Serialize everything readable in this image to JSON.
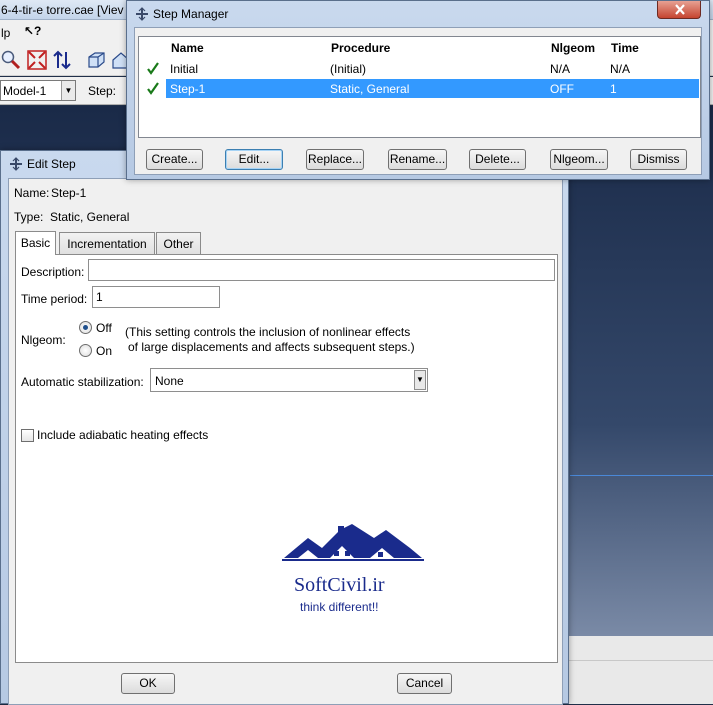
{
  "app": {
    "title": "6-4-tir-e torre.cae [Viev",
    "menu_help": "lp",
    "whatsthis": "↖?",
    "model_value": "Model-1",
    "step_label": "Step:"
  },
  "edit_step": {
    "title": "Edit Step",
    "name_label": "Name:",
    "name_value": "Step-1",
    "type_label": "Type:",
    "type_value": "Static, General",
    "tabs": [
      {
        "label": "Basic",
        "active": true
      },
      {
        "label": "Incrementation",
        "active": false
      },
      {
        "label": "Other",
        "active": false
      }
    ],
    "description_label": "Description:",
    "description_value": "",
    "time_period_label": "Time period:",
    "time_period_value": "1",
    "nlgeom_label": "Nlgeom:",
    "nlgeom_off_label": "Off",
    "nlgeom_on_label": "On",
    "nlgeom_selected": "Off",
    "nlgeom_note_line1": "(This setting controls the inclusion of nonlinear effects",
    "nlgeom_note_line2": "of large displacements and affects subsequent steps.)",
    "stabilization_label": "Automatic stabilization:",
    "stabilization_value": "None",
    "adiabatic_label": "Include adiabatic heating effects",
    "adiabatic_checked": false,
    "ok_label": "OK",
    "cancel_label": "Cancel"
  },
  "watermark": {
    "brand": "SoftCivil.ir",
    "slogan": "think different!!",
    "color": "#1a2b8c"
  },
  "step_manager": {
    "title": "Step Manager",
    "columns": [
      "Name",
      "Procedure",
      "Nlgeom",
      "Time"
    ],
    "rows": [
      {
        "name": "Initial",
        "procedure": "(Initial)",
        "nlgeom": "N/A",
        "time": "N/A",
        "selected": false
      },
      {
        "name": "Step-1",
        "procedure": "Static, General",
        "nlgeom": "OFF",
        "time": "1",
        "selected": true
      }
    ],
    "buttons": {
      "create": "Create...",
      "edit": "Edit...",
      "replace": "Replace...",
      "rename": "Rename...",
      "delete": "Delete...",
      "nlgeom": "Nlgeom...",
      "dismiss": "Dismiss"
    }
  },
  "colors": {
    "selection": "#3399ff",
    "check": "#1a7a1a",
    "viewport_top": "#1a2a48"
  }
}
